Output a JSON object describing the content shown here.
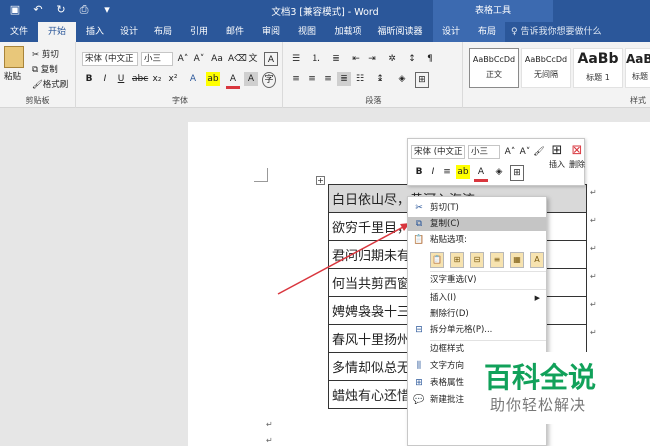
{
  "title_bar": {
    "quick_access": [
      "save-icon",
      "undo-icon",
      "redo-icon",
      "print-preview-icon",
      "customize-icon"
    ],
    "document_title": "文档3 [兼容模式] - Word",
    "context_title": "表格工具"
  },
  "tabs": [
    {
      "label": "文件"
    },
    {
      "label": "开始"
    },
    {
      "label": "插入"
    },
    {
      "label": "设计"
    },
    {
      "label": "布局"
    },
    {
      "label": "引用"
    },
    {
      "label": "邮件"
    },
    {
      "label": "审阅"
    },
    {
      "label": "视图"
    },
    {
      "label": "加载项"
    },
    {
      "label": "福昕阅读器"
    },
    {
      "label": "设计"
    },
    {
      "label": "布局"
    }
  ],
  "tell_me": "告诉我你想要做什么",
  "ribbon": {
    "clipboard": {
      "paste": "粘贴",
      "cut": "剪切",
      "copy": "复制",
      "format_painter": "格式刷",
      "label": "剪贴板"
    },
    "font": {
      "font_name": "宋体 (中文正",
      "font_size": "小三",
      "label": "字体"
    },
    "paragraph": {
      "label": "段落"
    },
    "styles": {
      "tiles": [
        {
          "preview": "AaBbCcDd",
          "name": "正文"
        },
        {
          "preview": "AaBbCcDd",
          "name": "无间隔"
        },
        {
          "preview": "AaBb",
          "name": "标题 1"
        },
        {
          "preview": "AaBb",
          "name": "标题"
        }
      ],
      "label": "样式"
    }
  },
  "document": {
    "table_rows": [
      "白日依山尽，黄河入海流",
      "欲穷千里目，更上一层楼",
      "君问归期未有期",
      "何当共剪西窗烛",
      "娉娉袅袅十三余",
      "春风十里扬州路",
      "多情却似总无情",
      "蜡烛有心还惜别"
    ],
    "paragraph_mark": "↵"
  },
  "mini_toolbar": {
    "font_name": "宋体 (中文正",
    "font_size": "小三",
    "insert_label": "插入",
    "delete_label": "删除"
  },
  "context_menu": {
    "cut": "剪切(T)",
    "copy": "复制(C)",
    "paste_options": "粘贴选项:",
    "hanzi_reconvert": "汉字重选(V)",
    "insert": "插入(I)",
    "delete_row": "删除行(D)",
    "split_cells": "拆分单元格(P)...",
    "border_styles": "边框样式",
    "text_direction": "文字方向",
    "table_properties": "表格属性",
    "new_comment": "新建批注"
  },
  "watermark": {
    "logo_text": "百科全说",
    "sub_text": "助你轻松解决"
  },
  "colors": {
    "word_blue": "#2b579a",
    "highlight_row": "#d9d9d9",
    "menu_highlight": "#c5c5c5",
    "arrow_red": "#d9363e",
    "watermark_green": "#11a15a"
  }
}
